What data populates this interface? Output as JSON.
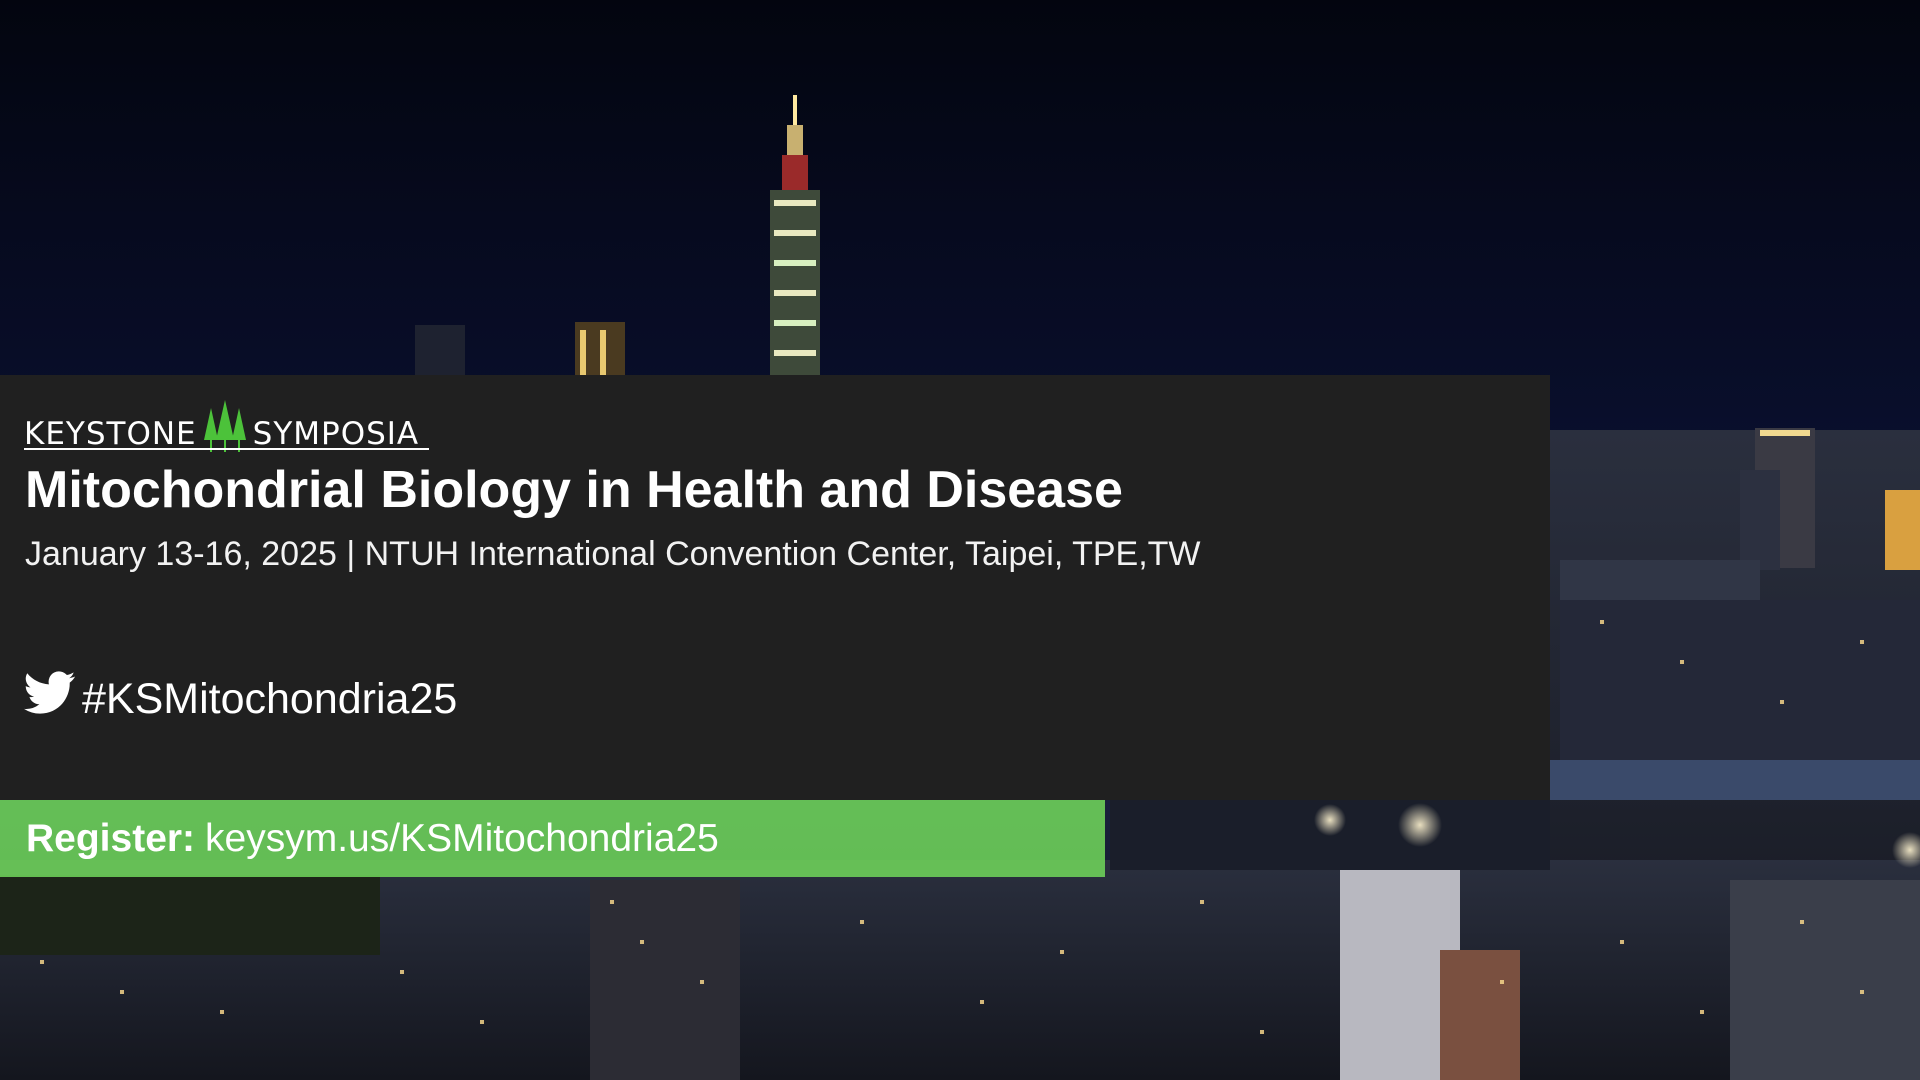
{
  "logo": {
    "left_word": "KEYSTONE",
    "right_word": "SYMPOSIA"
  },
  "event": {
    "title": "Mitochondrial Biology in Health and Disease",
    "details": "January 13-16, 2025 | NTUH International Convention Center, Taipei, TPE,TW"
  },
  "social": {
    "icon": "twitter-icon",
    "hashtag": "#KSMitochondria25"
  },
  "register": {
    "label": "Register:",
    "url": "keysym.us/KSMitochondria25"
  },
  "colors": {
    "panel": "#202020",
    "accent_green": "#6ED45A",
    "logo_trees": "#4CC23A",
    "sky": "#05081a"
  }
}
